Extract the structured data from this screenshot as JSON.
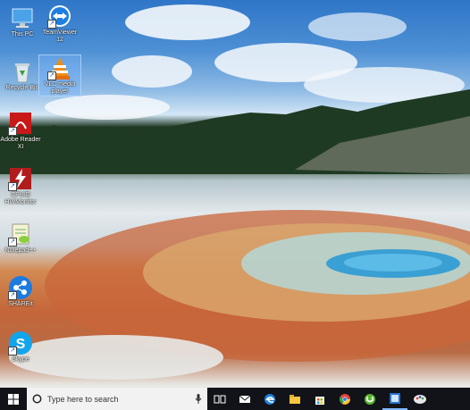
{
  "desktop_icons": [
    {
      "label": "This PC",
      "icon": "this-pc-icon"
    },
    {
      "label": "TeamViewer 12",
      "icon": "teamviewer-icon"
    },
    {
      "label": "Recycle Bin",
      "icon": "recycle-bin-icon"
    },
    {
      "label": "VLC media player",
      "icon": "vlc-icon"
    },
    {
      "label": "Adobe Reader XI",
      "icon": "adobe-reader-icon"
    },
    {
      "label": "CPUID HWMonitor",
      "icon": "hwmonitor-icon"
    },
    {
      "label": "Notepad++",
      "icon": "notepad-plus-plus-icon"
    },
    {
      "label": "SHAREit",
      "icon": "shareit-icon"
    },
    {
      "label": "Skype",
      "icon": "skype-icon"
    }
  ],
  "taskbar": {
    "search_placeholder": "Type here to search",
    "apps": [
      "task-view-icon",
      "mail-icon",
      "edge-icon",
      "file-explorer-icon",
      "store-icon",
      "chrome-icon",
      "utorrent-icon",
      "app-icon",
      "paint-icon"
    ]
  }
}
